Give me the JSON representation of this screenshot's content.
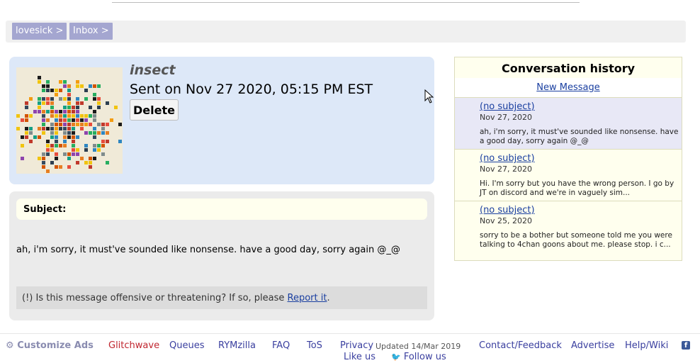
{
  "breadcrumbs": [
    {
      "label": "lovesick >"
    },
    {
      "label": "Inbox >"
    }
  ],
  "message": {
    "sender": "insect",
    "sent": "Sent on Nov 27 2020, 05:15 PM EST",
    "delete_label": "Delete",
    "subject_label": "Subject:",
    "body": "ah, i'm sorry, it must've sounded like nonsense. have a good day, sorry again @_@",
    "report_prefix": "(!) Is this message offensive or threatening? If so, please ",
    "report_link": "Report it",
    "report_suffix": "."
  },
  "conversation": {
    "title": "Conversation history",
    "new_message": "New Message",
    "items": [
      {
        "subject": "(no subject)",
        "date": "Nov 27, 2020",
        "snippet": "ah, i'm sorry, it must've sounded like nonsense. have a good day, sorry again @_@",
        "bg": "#e8e8f6"
      },
      {
        "subject": "(no subject)",
        "date": "Nov 27, 2020",
        "snippet": "Hi. I'm sorry but you have the wrong person. I go by JT on discord and we're in vaguely sim...",
        "bg": "#ffffee"
      },
      {
        "subject": "(no subject)",
        "date": "Nov 25, 2020",
        "snippet": "sorry to be a bother but someone told me you were talking to 4chan goons about me. please stop. i c...",
        "bg": "#ffffee"
      }
    ]
  },
  "footer": {
    "customize": "Customize Ads",
    "glitchwave": "Glitchwave",
    "queues": "Queues",
    "rymzilla": "RYMzilla",
    "faq": "FAQ",
    "tos": "ToS",
    "privacy": "Privacy",
    "updated": "Updated 14/Mar 2019",
    "contact": "Contact/Feedback",
    "advertise": "Advertise",
    "help": "Help/Wiki",
    "like": "Like us",
    "follow": "Follow us"
  },
  "colors": {
    "link": "#1a3fa0",
    "crumb_bg": "#a4a6d0",
    "glitchwave": "#c0262f"
  }
}
